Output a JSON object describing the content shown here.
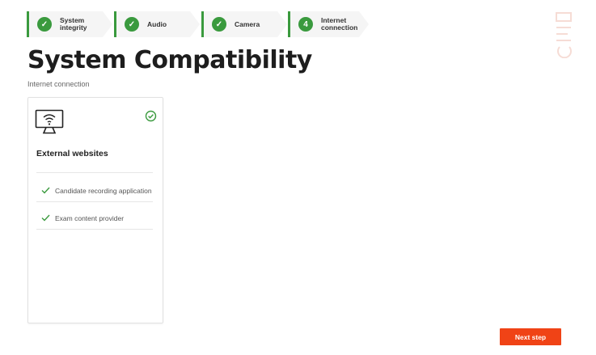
{
  "stepper": {
    "steps": [
      {
        "label": "System integrity",
        "badge": "✓",
        "status": "complete"
      },
      {
        "label": "Audio",
        "badge": "✓",
        "status": "complete"
      },
      {
        "label": "Camera",
        "badge": "✓",
        "status": "complete"
      },
      {
        "label": "Internet connection",
        "badge": "4",
        "status": "current"
      }
    ]
  },
  "page": {
    "title": "System Compatibility",
    "subtitle": "Internet connection"
  },
  "card": {
    "icon": "wifi-monitor-icon",
    "title": "External websites",
    "items": [
      {
        "label": "Candidate recording application",
        "status": "ok"
      },
      {
        "label": "Exam content provider",
        "status": "ok"
      }
    ]
  },
  "footer": {
    "next_label": "Next step"
  },
  "colors": {
    "success": "#3a9a3e",
    "accent": "#f04316"
  }
}
